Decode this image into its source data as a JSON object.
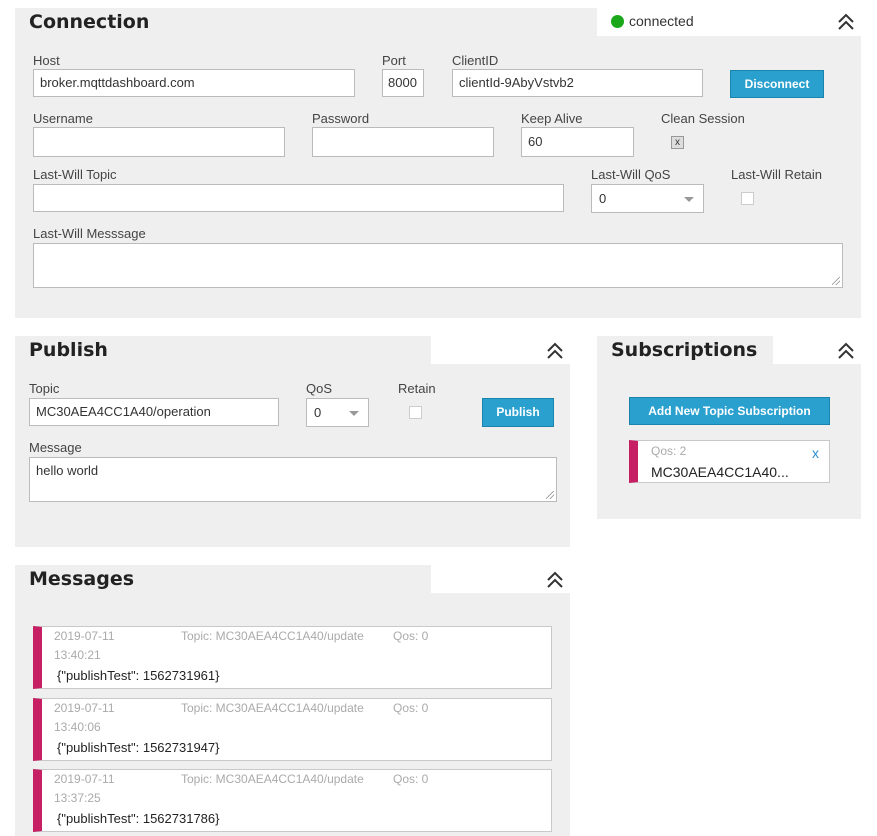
{
  "connection": {
    "title": "Connection",
    "status": "connected",
    "status_color": "#1aa71a",
    "host_label": "Host",
    "host_value": "broker.mqttdashboard.com",
    "port_label": "Port",
    "port_value": "8000",
    "clientid_label": "ClientID",
    "clientid_value": "clientId-9AbyVstvb2",
    "disconnect_label": "Disconnect",
    "username_label": "Username",
    "username_value": "",
    "password_label": "Password",
    "password_value": "",
    "keepalive_label": "Keep Alive",
    "keepalive_value": "60",
    "clean_session_label": "Clean Session",
    "clean_session_mark": "x",
    "lastwill_topic_label": "Last-Will Topic",
    "lastwill_topic_value": "",
    "lastwill_qos_label": "Last-Will QoS",
    "lastwill_qos_value": "0",
    "lastwill_retain_label": "Last-Will Retain",
    "lastwill_message_label": "Last-Will Messsage",
    "lastwill_message_value": ""
  },
  "publish": {
    "title": "Publish",
    "topic_label": "Topic",
    "topic_value": "MC30AEA4CC1A40/operation",
    "qos_label": "QoS",
    "qos_value": "0",
    "retain_label": "Retain",
    "publish_button": "Publish",
    "message_label": "Message",
    "message_value": "hello world"
  },
  "subscriptions": {
    "title": "Subscriptions",
    "add_button": "Add New Topic Subscription",
    "items": [
      {
        "qos": "Qos: 2",
        "topic": "MC30AEA4CC1A40...",
        "remove": "x",
        "color": "#c71f63"
      }
    ]
  },
  "messages": {
    "title": "Messages",
    "accent_color": "#c71f63",
    "items": [
      {
        "date": "2019-07-11",
        "time": "13:40:21",
        "topic": "Topic: MC30AEA4CC1A40/update",
        "qos": "Qos: 0",
        "payload": "{\"publishTest\": 1562731961}"
      },
      {
        "date": "2019-07-11",
        "time": "13:40:06",
        "topic": "Topic: MC30AEA4CC1A40/update",
        "qos": "Qos: 0",
        "payload": "{\"publishTest\": 1562731947}"
      },
      {
        "date": "2019-07-11",
        "time": "13:37:25",
        "topic": "Topic: MC30AEA4CC1A40/update",
        "qos": "Qos: 0",
        "payload": "{\"publishTest\": 1562731786}"
      }
    ]
  },
  "icons": {
    "collapse": "double-chevron-up-icon",
    "status": "status-dot-icon"
  }
}
